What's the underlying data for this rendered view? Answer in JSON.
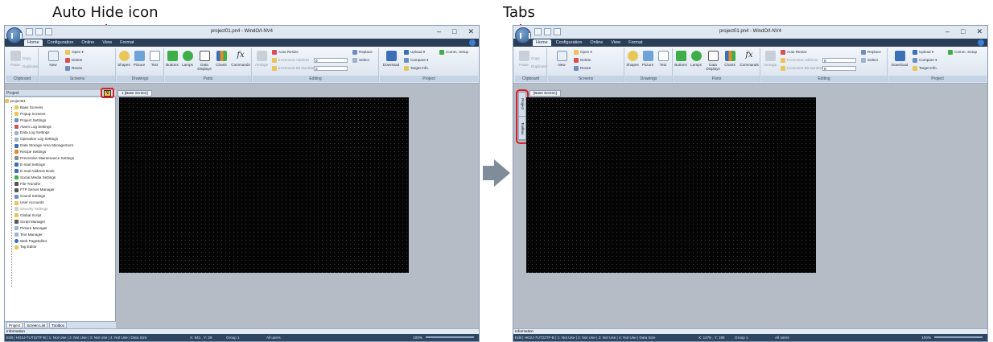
{
  "callouts": {
    "left": "Auto Hide icon",
    "right": "Tabs"
  },
  "window": {
    "title": "project01.pn4 - WindO/I-NV4",
    "controls": [
      "–",
      "□",
      "✕"
    ]
  },
  "menu_tabs": [
    "Home",
    "Configuration",
    "Online",
    "View",
    "Format"
  ],
  "ribbon": {
    "clipboard": {
      "label": "Clipboard",
      "items": [
        "Paste",
        "Copy",
        "Duplicate"
      ]
    },
    "screens": {
      "label": "Screens",
      "new": "New",
      "open": "Open ▾",
      "delete": "Delete",
      "reuse": "Reuse"
    },
    "drawings": {
      "label": "Drawings",
      "items": [
        "Shapes",
        "Picture",
        "Text"
      ]
    },
    "parts": {
      "label": "Parts",
      "items": [
        "Buttons",
        "Lamps",
        "Data Displays",
        "Charts",
        "Commands"
      ]
    },
    "editing": {
      "label": "Editing",
      "arrange": "Arrange",
      "auto_resize": "Auto Resize",
      "inc_addr": "Increment Address",
      "inc_bit": "Increment Bit Number",
      "inc_addr_value": "0",
      "inc_bit_value": "0",
      "replace": "Replace",
      "select": "Select"
    },
    "project": {
      "label": "Project",
      "download": "Download",
      "upload": "Upload ▾",
      "compare": "Compare ▾",
      "comm_setup": "Comm. Setup",
      "target_info": "Target Info."
    }
  },
  "panel": {
    "title": "Project",
    "auto_hide": "↯"
  },
  "tree": {
    "root": "project01",
    "items": [
      "Base Screens",
      "Popup Screens",
      "Project Settings",
      "Alarm Log Settings",
      "Data Log Settings",
      "Operation Log Settings",
      "Data Storage Area Management",
      "Recipe Settings",
      "Preventive Maintenance Settings",
      "E-mail Settings",
      "E-mail Address Book",
      "Social Media Settings",
      "File Transfer",
      "FTP Server Manager",
      "Sound Settings",
      "User Accounts",
      "Security Settings",
      "Global Script",
      "Script Manager",
      "Picture Manager",
      "Text Manager",
      "Web PageEditor",
      "Tag Editor"
    ],
    "greyed": "Security Settings"
  },
  "panel_tabs": [
    "Project",
    "Screen List",
    "Toolbox"
  ],
  "doc_tab": "1 [Base Screen]",
  "doc_tab_right": "[Base Screen]",
  "side_tabs": [
    "Project",
    "Toolbox"
  ],
  "info_label": "Information",
  "status": {
    "left": "Edit | HG2J-7UT22TF-B | 1: Not Use | 2: Not Use | 3: Not Use | 4: Not Use | Data Size",
    "coords_left": "X: 641 , Y: 26",
    "coords_right": "X: 1276 , Y: 185",
    "group": "Group 1",
    "all_users": "All users",
    "zoom": "100%"
  },
  "colors": {
    "callout_red": "#d6202a",
    "status_bg": "#2e4662",
    "canvas": "#050505"
  }
}
